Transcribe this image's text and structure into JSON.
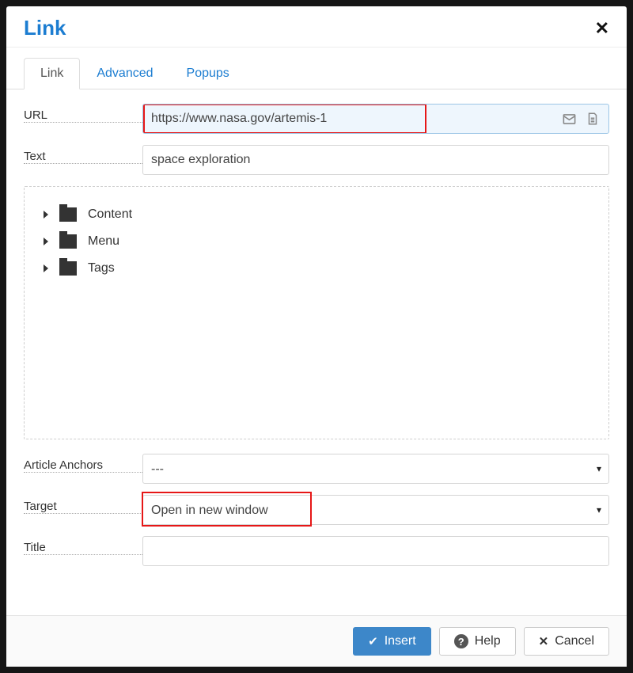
{
  "dialog": {
    "title": "Link",
    "tabs": [
      "Link",
      "Advanced",
      "Popups"
    ],
    "active_tab": 0
  },
  "fields": {
    "url": {
      "label": "URL",
      "value": "https://www.nasa.gov/artemis-1"
    },
    "text": {
      "label": "Text",
      "value": "space exploration"
    },
    "anchors": {
      "label": "Article Anchors",
      "value": "---"
    },
    "target": {
      "label": "Target",
      "value": "Open in new window"
    },
    "title": {
      "label": "Title",
      "value": ""
    }
  },
  "tree": {
    "items": [
      "Content",
      "Menu",
      "Tags"
    ]
  },
  "buttons": {
    "insert": "Insert",
    "help": "Help",
    "cancel": "Cancel"
  }
}
